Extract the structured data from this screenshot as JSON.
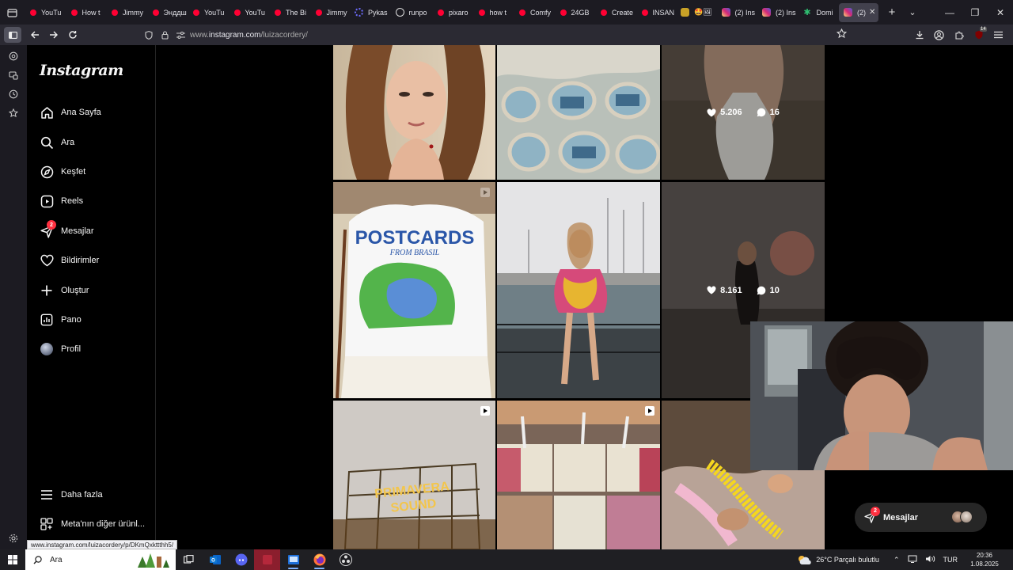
{
  "browser": {
    "tabs": [
      {
        "title": "YouTu",
        "icon": "youtube-icon",
        "color": "#ff0033"
      },
      {
        "title": "How t",
        "icon": "youtube-icon",
        "color": "#ff0033"
      },
      {
        "title": "Jimmy",
        "icon": "youtube-icon",
        "color": "#ff0033"
      },
      {
        "title": "Энддш",
        "icon": "youtube-icon",
        "color": "#ff0033"
      },
      {
        "title": "YouTu",
        "icon": "youtube-icon",
        "color": "#ff0033"
      },
      {
        "title": "YouTu",
        "icon": "youtube-icon",
        "color": "#ff0033"
      },
      {
        "title": "The Bi",
        "icon": "youtube-icon",
        "color": "#ff0033"
      },
      {
        "title": "Jimmy",
        "icon": "youtube-icon",
        "color": "#ff0033"
      },
      {
        "title": "Pykas",
        "icon": "gear-icon",
        "color": "#6d6dff"
      },
      {
        "title": "runpo",
        "icon": "globe-icon",
        "color": "#dddddd"
      },
      {
        "title": "pixaro",
        "icon": "youtube-icon",
        "color": "#ff0033"
      },
      {
        "title": "how t",
        "icon": "youtube-icon",
        "color": "#ff0033"
      },
      {
        "title": "Comfy",
        "icon": "youtube-icon",
        "color": "#ff0033"
      },
      {
        "title": "24GB",
        "icon": "youtube-icon",
        "color": "#ff0033"
      },
      {
        "title": "Create",
        "icon": "youtube-icon",
        "color": "#ff0033"
      },
      {
        "title": "INSAN",
        "icon": "youtube-icon",
        "color": "#ff0033"
      },
      {
        "title": "🤩🖼",
        "icon": "image-icon",
        "color": "#c9a227"
      },
      {
        "title": "(2) Ins",
        "icon": "instagram-icon",
        "color": "#d62976"
      },
      {
        "title": "(2) Ins",
        "icon": "instagram-icon",
        "color": "#d62976"
      },
      {
        "title": "Domi",
        "icon": "palm-icon",
        "color": "#2fbf71"
      },
      {
        "title": "(2)",
        "icon": "instagram-icon",
        "color": "#d62976",
        "active": true
      }
    ],
    "url_prefix": "www.",
    "url_domain": "instagram.com",
    "url_path": "/luizacordery/",
    "downloads_badge": "14",
    "status_url": "www.instagram.com/luizacordery/p/DKmQxkttthh5/"
  },
  "instagram": {
    "logo": "Instagram",
    "nav": [
      {
        "label": "Ana Sayfa",
        "icon": "home-icon",
        "name": "nav-home"
      },
      {
        "label": "Ara",
        "icon": "search-icon",
        "name": "nav-search"
      },
      {
        "label": "Keşfet",
        "icon": "compass-icon",
        "name": "nav-explore"
      },
      {
        "label": "Reels",
        "icon": "reels-icon",
        "name": "nav-reels"
      },
      {
        "label": "Mesajlar",
        "icon": "messenger-icon",
        "name": "nav-messages",
        "badge": "2"
      },
      {
        "label": "Bildirimler",
        "icon": "heart-icon",
        "name": "nav-notifications"
      },
      {
        "label": "Oluştur",
        "icon": "plus-icon",
        "name": "nav-create"
      },
      {
        "label": "Pano",
        "icon": "dashboard-icon",
        "name": "nav-dashboard"
      },
      {
        "label": "Profil",
        "icon": "avatar",
        "name": "nav-profile"
      }
    ],
    "bottom_nav": [
      {
        "label": "Daha fazla",
        "icon": "menu-icon",
        "name": "nav-more"
      },
      {
        "label": "Meta'nın diğer ürünl...",
        "icon": "threads-icon",
        "name": "nav-meta-products"
      }
    ],
    "posts": [
      {
        "likes": "5.206",
        "comments": "16",
        "hovered": true,
        "reel": false
      },
      {
        "likes": "8.161",
        "comments": "10",
        "hovered": true,
        "reel": false
      }
    ],
    "messages_pill": {
      "label": "Mesajlar",
      "badge": "2"
    }
  },
  "taskbar": {
    "search_placeholder": "Ara",
    "weather": "26°C  Parçalı bulutlu",
    "lang": "TUR",
    "time": "20:36",
    "date": "1.08.2025"
  }
}
